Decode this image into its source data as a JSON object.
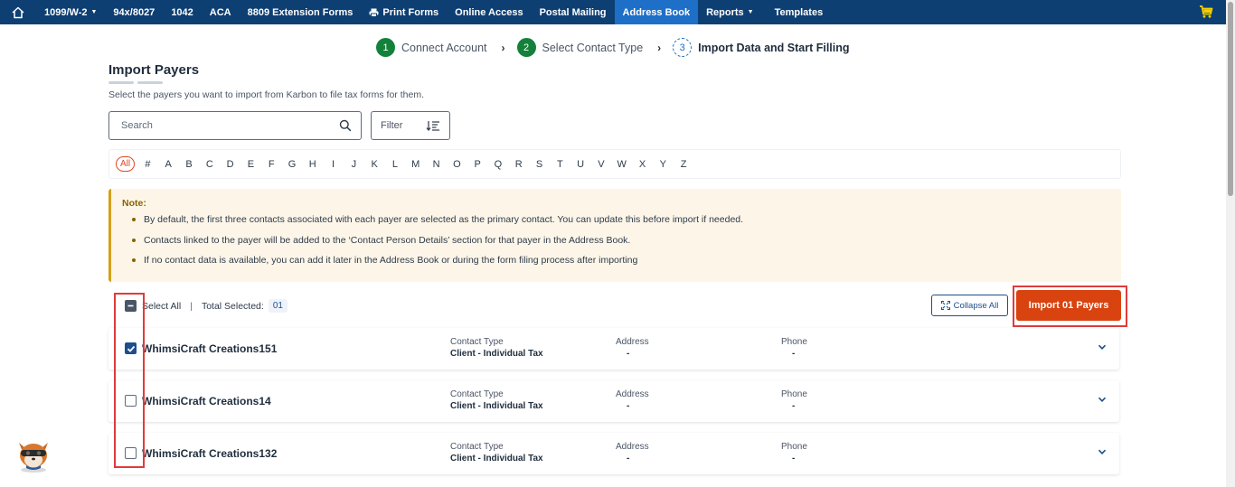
{
  "nav": {
    "items": [
      {
        "label": "1099/W-2",
        "caret": true,
        "active": false
      },
      {
        "label": "94x/8027",
        "caret": false,
        "active": false
      },
      {
        "label": "1042",
        "caret": false,
        "active": false
      },
      {
        "label": "ACA",
        "caret": false,
        "active": false
      },
      {
        "label": "8809 Extension Forms",
        "caret": false,
        "active": false
      },
      {
        "label": "Print Forms",
        "caret": false,
        "active": false
      },
      {
        "label": "Online Access",
        "caret": false,
        "active": false
      },
      {
        "label": "Postal Mailing",
        "caret": false,
        "active": false
      },
      {
        "label": "Address Book",
        "caret": false,
        "active": true
      },
      {
        "label": "Reports",
        "caret": true,
        "active": false
      },
      {
        "label": "Templates",
        "caret": false,
        "active": false
      }
    ]
  },
  "stepper": {
    "steps": [
      {
        "num": "1",
        "label": "Connect Account",
        "state": "done"
      },
      {
        "num": "2",
        "label": "Select Contact Type",
        "state": "done"
      },
      {
        "num": "3",
        "label": "Import Data and Start Filling",
        "state": "current"
      }
    ]
  },
  "page": {
    "title": "Import Payers",
    "subtitle": "Select the payers you want to import from Karbon to file tax forms for them."
  },
  "search": {
    "placeholder": "Search",
    "value": ""
  },
  "filter": {
    "label": "Filter"
  },
  "alphabet": [
    "All",
    "#",
    "A",
    "B",
    "C",
    "D",
    "E",
    "F",
    "G",
    "H",
    "I",
    "J",
    "K",
    "L",
    "M",
    "N",
    "O",
    "P",
    "Q",
    "R",
    "S",
    "T",
    "U",
    "V",
    "W",
    "X",
    "Y",
    "Z"
  ],
  "note": {
    "title": "Note:",
    "items": [
      "By default, the first three contacts associated with each payer are selected as the primary contact. You can update this before import if needed.",
      "Contacts linked to the payer will be added to the ‘Contact Person Details’ section for that payer in the Address Book.",
      "If no contact data is available, you can add it later in the Address Book or during the form filing process after importing"
    ]
  },
  "selection": {
    "select_all_label": "Select All",
    "separator": "|",
    "total_label": "Total Selected:",
    "total_count": "01"
  },
  "buttons": {
    "collapse_all": "Collapse All",
    "import": "Import 01 Payers"
  },
  "columns": {
    "contact_type": "Contact Type",
    "address": "Address",
    "phone": "Phone"
  },
  "payers": [
    {
      "name": "WhimsiCraft Creations151",
      "checked": true,
      "contact_type": "Client - Individual Tax",
      "address": "-",
      "phone": "-"
    },
    {
      "name": "WhimsiCraft Creations14",
      "checked": false,
      "contact_type": "Client - Individual Tax",
      "address": "-",
      "phone": "-"
    },
    {
      "name": "WhimsiCraft Creations132",
      "checked": false,
      "contact_type": "Client - Individual Tax",
      "address": "-",
      "phone": "-"
    }
  ],
  "colors": {
    "nav_bg": "#0d3f73",
    "nav_active": "#1e6fc7",
    "step_done": "#13813a",
    "import_btn": "#d9430f",
    "highlight": "#e03b3b",
    "note_bg": "#fdf6e8"
  },
  "icons": {
    "home": "home-icon",
    "cart": "cart-icon",
    "search": "search-icon",
    "filter": "sort-icon",
    "collapse": "collapse-icon",
    "chevron": "chevron-down-icon",
    "print": "printer-icon"
  }
}
